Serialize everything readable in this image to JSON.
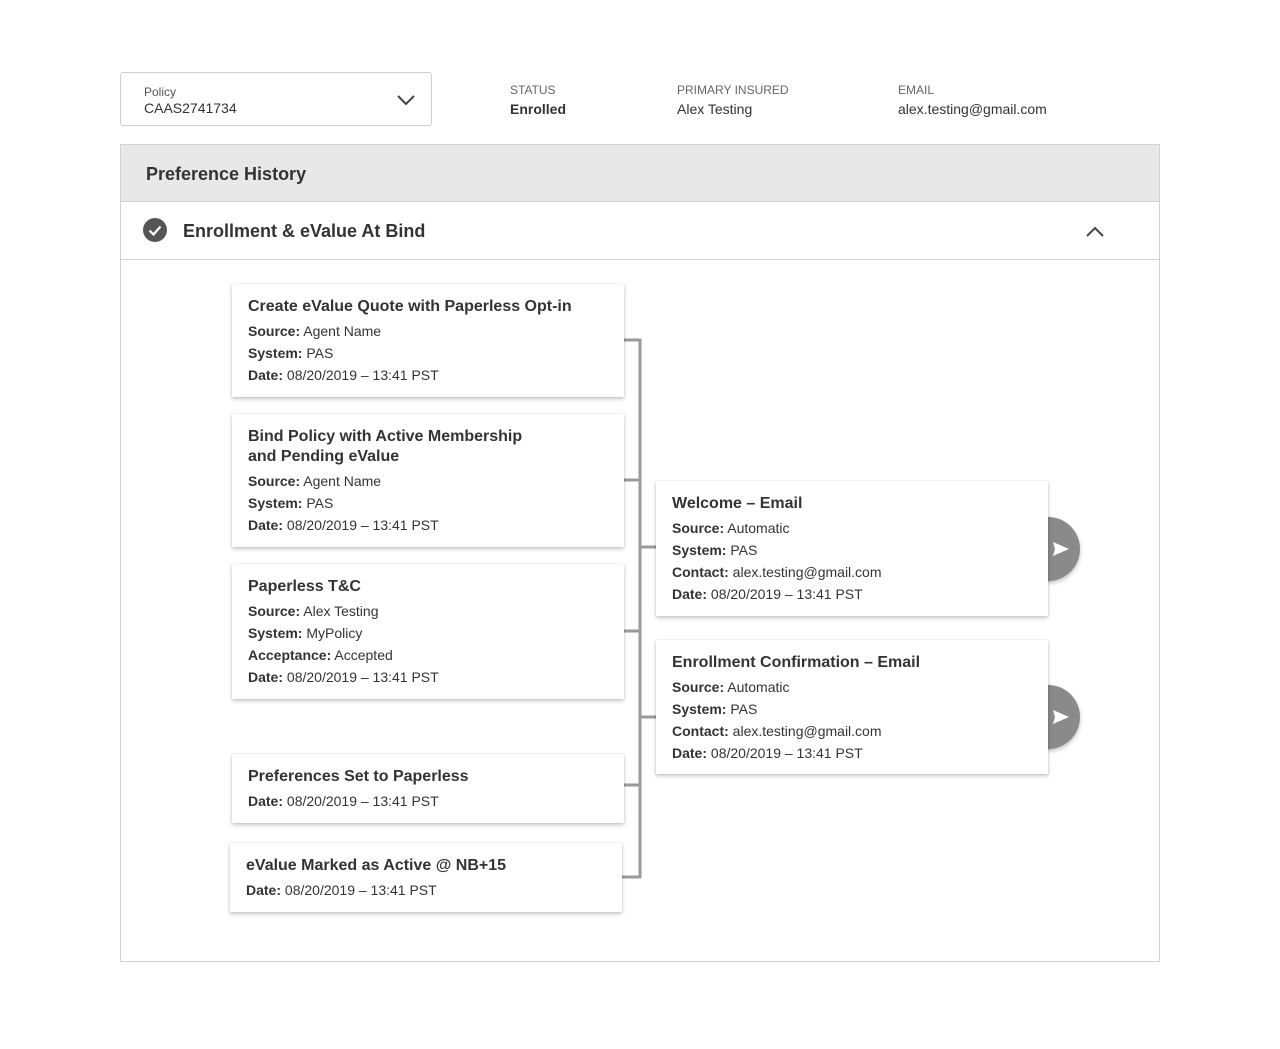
{
  "header": {
    "policy": {
      "label": "Policy",
      "value": "CAAS2741734"
    },
    "status": {
      "label": "STATUS",
      "value": "Enrolled"
    },
    "primary_insured": {
      "label": "PRIMARY INSURED",
      "value": "Alex Testing"
    },
    "email": {
      "label": "EMAIL",
      "value": "alex.testing@gmail.com"
    }
  },
  "panel": {
    "title": "Preference History",
    "section": {
      "title": "Enrollment & eValue At Bind",
      "icon": "check-circle-icon",
      "expanded": true
    }
  },
  "events": [
    {
      "title": "Create eValue Quote with Paperless Opt-in",
      "fields": [
        {
          "k": "Source:",
          "v": "Agent Name"
        },
        {
          "k": "System:",
          "v": "PAS"
        },
        {
          "k": "Date:",
          "v": "08/20/2019 – 13:41 PST"
        }
      ]
    },
    {
      "title": "Bind Policy with Active Membership and Pending eValue",
      "fields": [
        {
          "k": "Source:",
          "v": "Agent Name"
        },
        {
          "k": "System:",
          "v": "PAS"
        },
        {
          "k": "Date:",
          "v": "08/20/2019 – 13:41 PST"
        }
      ]
    },
    {
      "title": "Paperless T&C",
      "fields": [
        {
          "k": "Source:",
          "v": "Alex Testing"
        },
        {
          "k": "System:",
          "v": "MyPolicy"
        },
        {
          "k": "Acceptance:",
          "v": "Accepted"
        },
        {
          "k": "Date:",
          "v": "08/20/2019 – 13:41 PST"
        }
      ]
    },
    {
      "title": "Preferences Set to Paperless",
      "fields": [
        {
          "k": "Date:",
          "v": "08/20/2019 – 13:41 PST"
        }
      ]
    },
    {
      "title": "eValue Marked as Active @ NB+15",
      "fields": [
        {
          "k": "Date:",
          "v": "08/20/2019 – 13:41 PST"
        }
      ]
    }
  ],
  "communications": [
    {
      "title": "Welcome – Email",
      "fields": [
        {
          "k": "Source:",
          "v": "Automatic"
        },
        {
          "k": "System:",
          "v": "PAS"
        },
        {
          "k": "Contact:",
          "v": "alex.testing@gmail.com"
        },
        {
          "k": "Date:",
          "v": "08/20/2019 – 13:41 PST"
        }
      ]
    },
    {
      "title": "Enrollment Confirmation – Email",
      "fields": [
        {
          "k": "Source:",
          "v": "Automatic"
        },
        {
          "k": "System:",
          "v": "PAS"
        },
        {
          "k": "Contact:",
          "v": "alex.testing@gmail.com"
        },
        {
          "k": "Date:",
          "v": "08/20/2019 – 13:41 PST"
        }
      ]
    }
  ],
  "colors": {
    "connector": "#9a9a9a",
    "send_button": "#8a8a8a",
    "panel_header": "#e8e8e8"
  }
}
